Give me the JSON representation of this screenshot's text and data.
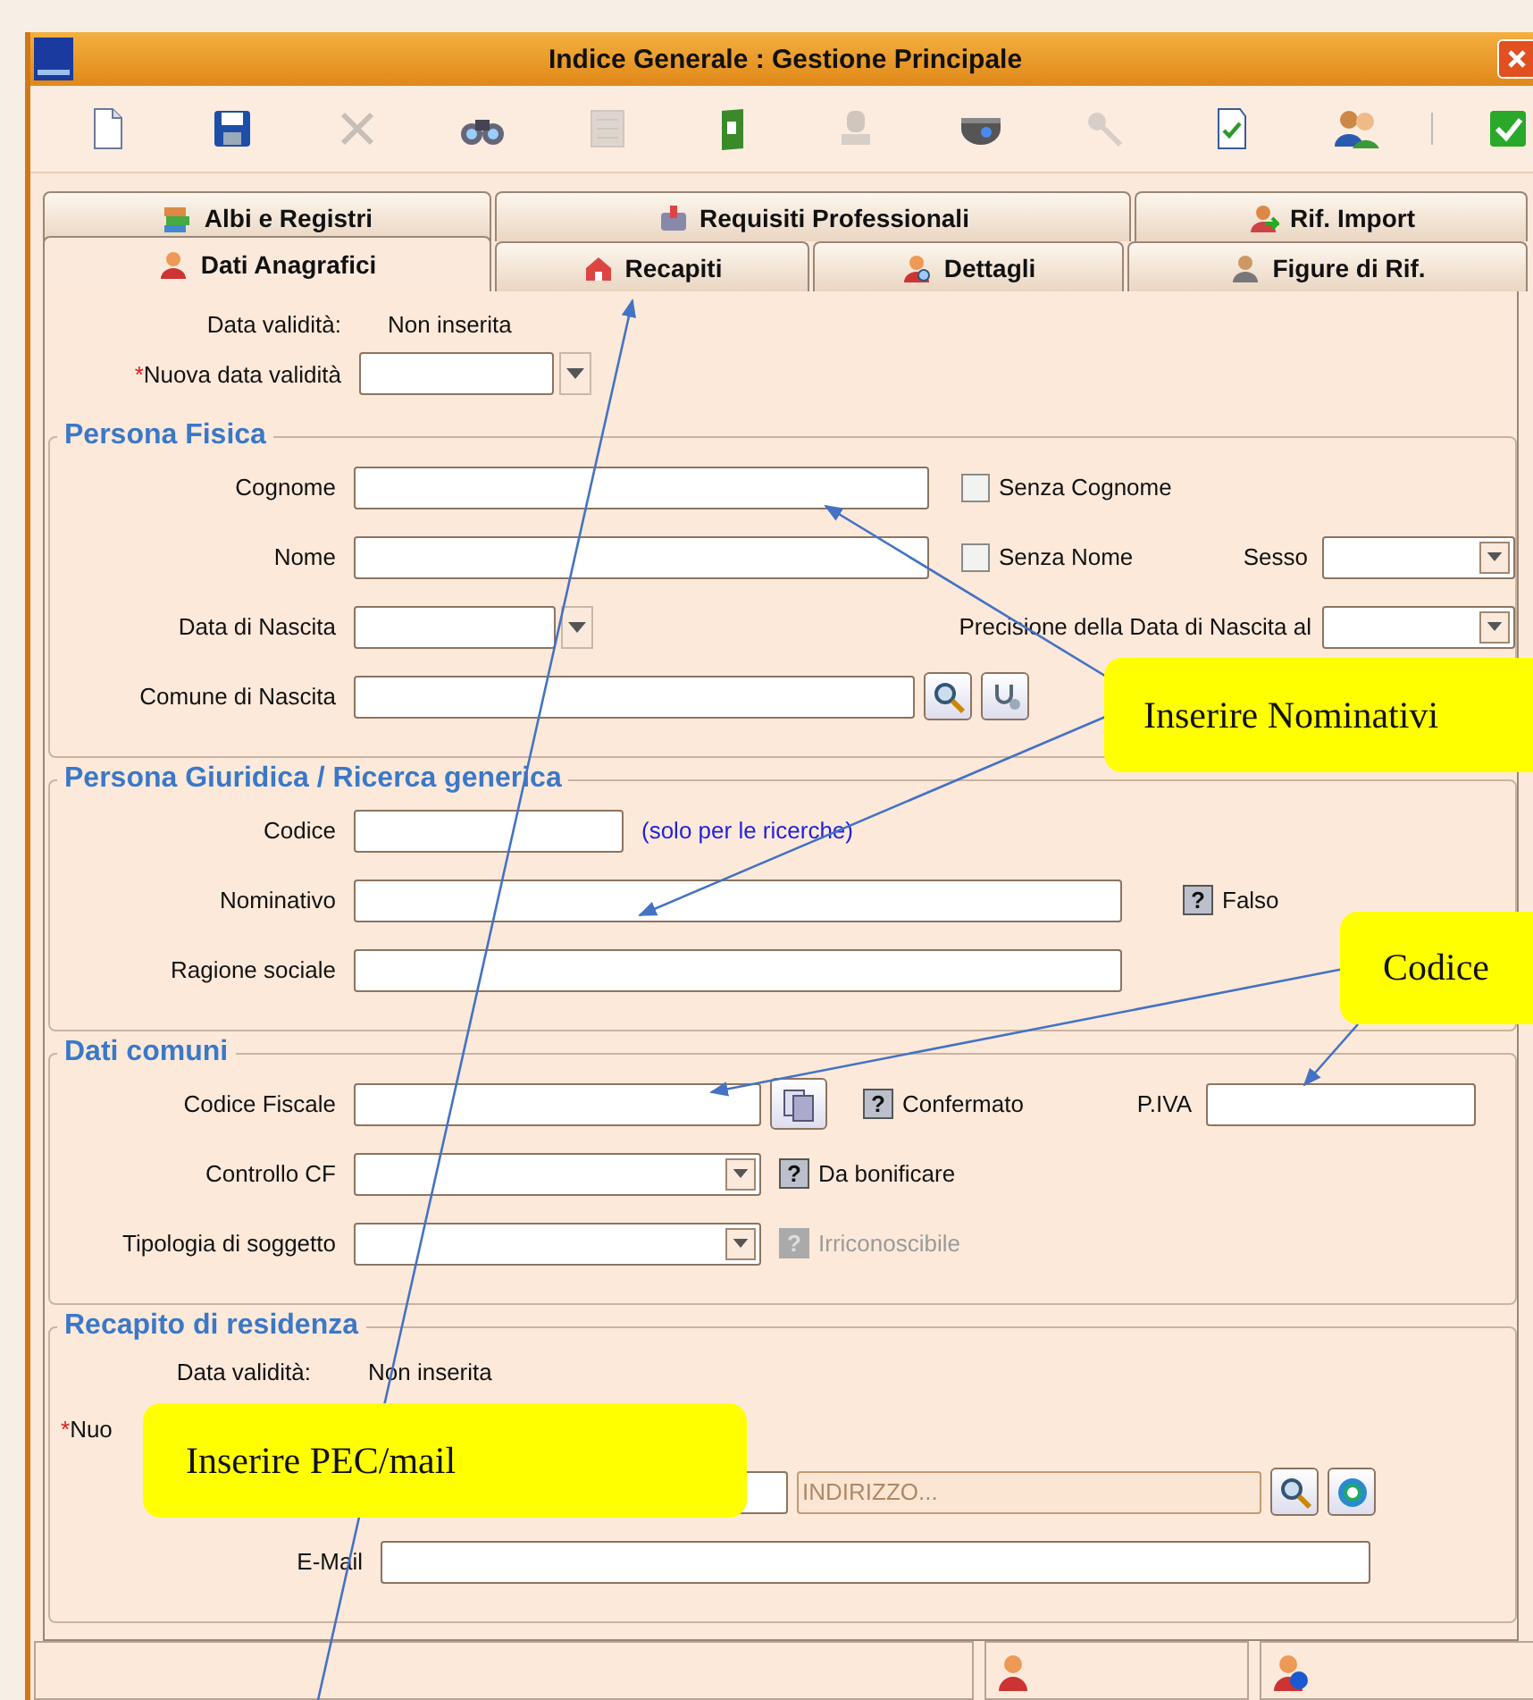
{
  "window": {
    "title": "Indice Generale : Gestione Principale"
  },
  "toolbar": [
    {
      "kind": "new-doc",
      "disabled": false
    },
    {
      "kind": "save",
      "disabled": false
    },
    {
      "kind": "delete",
      "disabled": true
    },
    {
      "kind": "binoculars",
      "disabled": false
    },
    {
      "kind": "grid",
      "disabled": true
    },
    {
      "kind": "binder",
      "disabled": false
    },
    {
      "kind": "stamp",
      "disabled": true
    },
    {
      "kind": "camera",
      "disabled": false
    },
    {
      "kind": "key",
      "disabled": true
    },
    {
      "kind": "check-doc",
      "disabled": false
    },
    {
      "kind": "users",
      "disabled": false
    },
    {
      "kind": "separator"
    },
    {
      "kind": "confirm",
      "disabled": false
    }
  ],
  "tabs": {
    "row_1": [
      {
        "label": "Albi e Registri",
        "kind": "books",
        "selected": false
      },
      {
        "label": "Requisiti Professionali",
        "kind": "folder",
        "selected": false
      },
      {
        "label": "Rif. Import",
        "kind": "user-arrow",
        "selected": false
      }
    ],
    "row_2": [
      {
        "label": "Dati Anagrafici",
        "kind": "user",
        "selected": true
      },
      {
        "label": "Recapiti",
        "kind": "house",
        "selected": false
      },
      {
        "label": "Dettagli",
        "kind": "user-search",
        "selected": false
      },
      {
        "label": "Figure di Rif.",
        "kind": "user-grey",
        "selected": false
      }
    ]
  },
  "validity": {
    "label": "Data validità:",
    "value": "Non inserita"
  },
  "new_validity": {
    "marker": "*",
    "label": "Nuova data validità"
  },
  "persona_fisica": {
    "title": "Persona Fisica",
    "cognome": {
      "label": "Cognome"
    },
    "no_cognome": {
      "label": "Senza Cognome",
      "checked": false
    },
    "nome": {
      "label": "Nome"
    },
    "no_nome": {
      "label": "Senza Nome",
      "checked": false
    },
    "sesso": {
      "label": "Sesso"
    },
    "nascita": {
      "label": "Data di Nascita"
    },
    "precisione": {
      "label": "Precisione della Data di Nascita al"
    },
    "comune": {
      "label": "Comune di Nascita"
    }
  },
  "persona_giuridica": {
    "title": "Persona Giuridica / Ricerca generica",
    "codice": {
      "label": "Codice",
      "hint": "(solo per le ricerche)"
    },
    "nominativo": {
      "label": "Nominativo"
    },
    "falso": {
      "mark": "?",
      "label": "Falso",
      "disabled": false
    },
    "ragione": {
      "label": "Ragione sociale"
    }
  },
  "dati_comuni": {
    "title": "Dati comuni",
    "cf": {
      "label": "Codice Fiscale"
    },
    "confermato": {
      "mark": "?",
      "label": "Confermato",
      "disabled": false
    },
    "piva": {
      "label": "P.IVA"
    },
    "controllo": {
      "label": "Controllo CF"
    },
    "bonificare": {
      "mark": "?",
      "label": "Da bonificare",
      "disabled": false
    },
    "tipologia": {
      "label": "Tipologia di soggetto"
    },
    "irriconoscibile": {
      "mark": "?",
      "label": "Irriconoscibile",
      "disabled": true
    }
  },
  "recapito": {
    "title": "Recapito di residenza",
    "validity": {
      "label": "Data validità:",
      "value": "Non inserita"
    },
    "new_validity": {
      "marker": "*",
      "label": "Nuo"
    },
    "address": {
      "placeholder": "INDIRIZZO..."
    },
    "email": {
      "label": "E-Mail"
    }
  },
  "status_bar": [
    {
      "kind": "empty"
    },
    {
      "kind": "user"
    },
    {
      "kind": "user-info"
    }
  ],
  "callouts": [
    {
      "text": "Inserire Nominativi"
    },
    {
      "text": "Codice"
    },
    {
      "text": "Inserire PEC/mail"
    }
  ]
}
